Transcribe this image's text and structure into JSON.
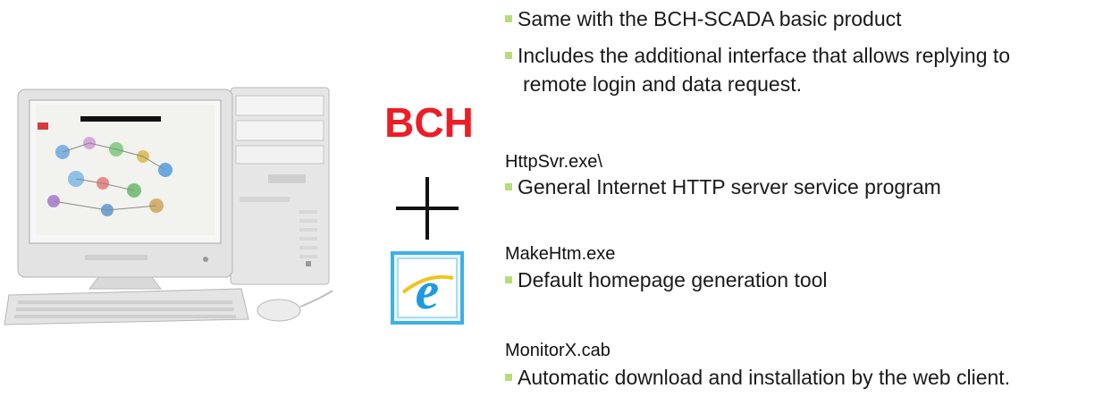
{
  "left": {
    "logo_text": "BCH"
  },
  "bullets_top": [
    "Same with the BCH-SCADA basic product",
    "Includes the additional interface that allows replying to",
    "remote login and data request."
  ],
  "sections": [
    {
      "title": "HttpSvr.exe\\",
      "bullet": "General Internet HTTP server service program"
    },
    {
      "title": "MakeHtm.exe",
      "bullet": "Default homepage generation tool"
    },
    {
      "title": "MonitorX.cab",
      "bullet": "Automatic download and installation by the web client."
    }
  ],
  "colors": {
    "logo_red": "#ee1c25",
    "bullet_green": "#b6dd7a",
    "ie_blue": "#1f9ae0"
  },
  "icons": [
    "desktop-computer-icon",
    "plus-icon",
    "internet-explorer-icon"
  ]
}
